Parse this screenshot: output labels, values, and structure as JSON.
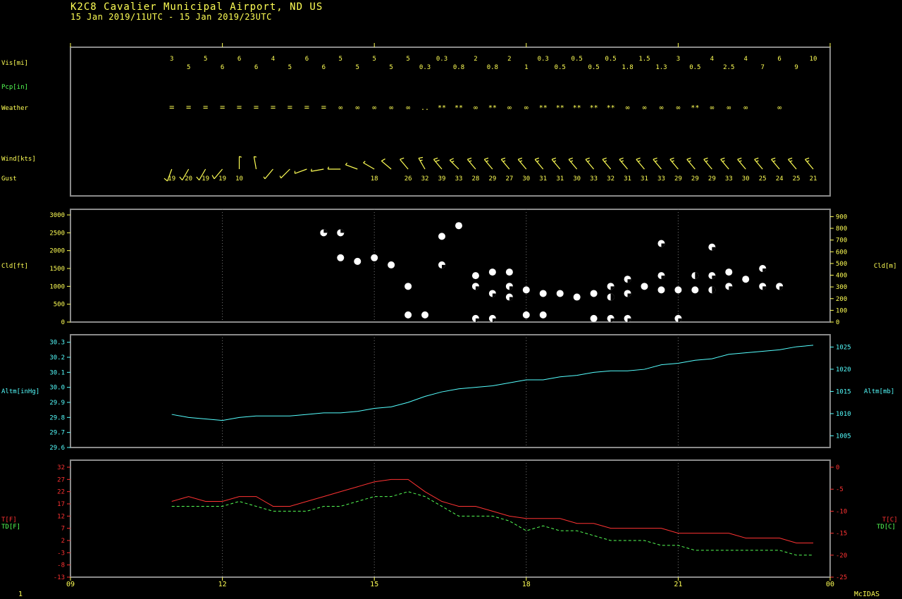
{
  "header": {
    "title": "K2C8  Cavalier Municipal Airport, ND US",
    "subtitle": "15 Jan 2019/11UTC - 15 Jan 2019/23UTC"
  },
  "footer": {
    "page": "1",
    "brand": "McIDAS"
  },
  "colors": {
    "yellow": "#ffff55",
    "green": "#55ff55",
    "cyan": "#55ffff",
    "red": "#ff3333",
    "panel": "#8a8a8a",
    "grid": "#777777"
  },
  "chart_data": [
    {
      "type": "table",
      "row_labels": {
        "vis": "Vis[mi]",
        "pcp": "Pcp[in]",
        "weather": "Weather",
        "wind": "Wind[kts]",
        "gust": "Gust"
      },
      "x_hours": [
        11,
        11.333,
        11.667,
        12,
        12.333,
        12.667,
        13,
        13.333,
        13.667,
        14,
        14.333,
        14.667,
        15,
        15.333,
        15.667,
        16,
        16.333,
        16.667,
        17,
        17.333,
        17.667,
        18,
        18.333,
        18.667,
        19,
        19.333,
        19.667,
        20,
        20.333,
        20.667,
        21,
        21.333,
        21.667,
        22,
        22.333,
        22.667,
        23,
        23.333,
        23.667
      ],
      "visibility": [
        "3",
        "5",
        "5",
        "6",
        "6",
        "6",
        "4",
        "5",
        "6",
        "6",
        "5",
        "5",
        "5",
        "5",
        "5",
        "0.3",
        "0.3",
        "0.8",
        "2",
        "0.8",
        "2",
        "1",
        "0.3",
        "0.5",
        "0.5",
        "0.5",
        "0.5",
        "1.8",
        "1.5",
        "1.3",
        "3",
        "0.5",
        "4",
        "2.5",
        "4",
        "7",
        "6",
        "9",
        "10"
      ],
      "weather": [
        "=",
        "=",
        "=",
        "=",
        "=",
        "=",
        "=",
        "=",
        "=",
        "=",
        "∞",
        "∞",
        "∞",
        "∞",
        "∞",
        "..",
        "**",
        "**",
        "∞",
        "**",
        "∞",
        "∞",
        "**",
        "**",
        "**",
        "**",
        "**",
        "∞",
        "∞",
        "∞",
        "∞",
        "**",
        "∞",
        "∞",
        "∞",
        "",
        "∞",
        "",
        ""
      ],
      "wind_dir_deg": [
        200,
        210,
        210,
        220,
        360,
        350,
        220,
        225,
        250,
        260,
        270,
        290,
        300,
        310,
        320,
        330,
        320,
        315,
        320,
        320,
        320,
        320,
        320,
        320,
        320,
        320,
        320,
        320,
        320,
        320,
        320,
        320,
        320,
        320,
        320,
        320,
        320,
        320,
        320
      ],
      "wind_speed_kts": [
        13,
        13,
        13,
        12,
        8,
        8,
        5,
        5,
        7,
        7,
        7,
        8,
        9,
        11,
        13,
        17,
        21,
        17,
        17,
        17,
        17,
        17,
        17,
        17,
        17,
        17,
        17,
        17,
        17,
        17,
        17,
        17,
        17,
        17,
        17,
        17,
        17,
        17,
        17
      ],
      "gusts": [
        {
          "x": 11,
          "v": "19"
        },
        {
          "x": 11.333,
          "v": "20"
        },
        {
          "x": 11.667,
          "v": "19"
        },
        {
          "x": 12,
          "v": "19"
        },
        {
          "x": 12.333,
          "v": "10"
        },
        {
          "x": 15,
          "v": "18"
        },
        {
          "x": 15.667,
          "v": "26"
        },
        {
          "x": 16,
          "v": "32"
        },
        {
          "x": 16.333,
          "v": "39"
        },
        {
          "x": 16.667,
          "v": "33"
        },
        {
          "x": 17,
          "v": "28"
        },
        {
          "x": 17.333,
          "v": "29"
        },
        {
          "x": 17.667,
          "v": "27"
        },
        {
          "x": 18,
          "v": "30"
        },
        {
          "x": 18.333,
          "v": "31"
        },
        {
          "x": 18.667,
          "v": "31"
        },
        {
          "x": 19,
          "v": "30"
        },
        {
          "x": 19.333,
          "v": "33"
        },
        {
          "x": 19.667,
          "v": "32"
        },
        {
          "x": 20,
          "v": "31"
        },
        {
          "x": 20.333,
          "v": "31"
        },
        {
          "x": 20.667,
          "v": "33"
        },
        {
          "x": 21,
          "v": "29"
        },
        {
          "x": 21.333,
          "v": "29"
        },
        {
          "x": 21.667,
          "v": "29"
        },
        {
          "x": 22,
          "v": "33"
        },
        {
          "x": 22.333,
          "v": "30"
        },
        {
          "x": 22.667,
          "v": "25"
        },
        {
          "x": 23,
          "v": "24"
        },
        {
          "x": 23.333,
          "v": "25"
        },
        {
          "x": 23.667,
          "v": "21"
        }
      ]
    },
    {
      "type": "scatter",
      "ylabel_left": "Cld[ft]",
      "ylabel_right": "Cld[m]",
      "ylim": [
        0,
        3000
      ],
      "yticks_left": [
        0,
        500,
        1000,
        1500,
        2000,
        2500,
        3000
      ],
      "yticks_right_m": [
        0,
        100,
        200,
        300,
        400,
        500,
        600,
        700,
        800,
        900
      ],
      "points": [
        {
          "x": 14,
          "y": 2500,
          "c": "few"
        },
        {
          "x": 14.333,
          "y": 2500,
          "c": "few"
        },
        {
          "x": 14.333,
          "y": 1800,
          "c": "ovc"
        },
        {
          "x": 14.667,
          "y": 1700,
          "c": "ovc"
        },
        {
          "x": 15,
          "y": 1800,
          "c": "ovc"
        },
        {
          "x": 15.333,
          "y": 1600,
          "c": "ovc"
        },
        {
          "x": 15.667,
          "y": 1000,
          "c": "ovc"
        },
        {
          "x": 15.667,
          "y": 200,
          "c": "ovc"
        },
        {
          "x": 16,
          "y": 200,
          "c": "ovc"
        },
        {
          "x": 16.333,
          "y": 2400,
          "c": "ovc"
        },
        {
          "x": 16.333,
          "y": 1600,
          "c": "bkn"
        },
        {
          "x": 16.667,
          "y": 2700,
          "c": "ovc"
        },
        {
          "x": 17,
          "y": 1300,
          "c": "ovc"
        },
        {
          "x": 17,
          "y": 1000,
          "c": "bkn"
        },
        {
          "x": 17,
          "y": 100,
          "c": "bkn"
        },
        {
          "x": 17.333,
          "y": 1400,
          "c": "ovc"
        },
        {
          "x": 17.333,
          "y": 800,
          "c": "bkn"
        },
        {
          "x": 17.333,
          "y": 100,
          "c": "bkn"
        },
        {
          "x": 17.667,
          "y": 1400,
          "c": "ovc"
        },
        {
          "x": 17.667,
          "y": 1000,
          "c": "bkn"
        },
        {
          "x": 17.667,
          "y": 700,
          "c": "bkn"
        },
        {
          "x": 18,
          "y": 900,
          "c": "ovc"
        },
        {
          "x": 18,
          "y": 200,
          "c": "ovc"
        },
        {
          "x": 18.333,
          "y": 800,
          "c": "ovc"
        },
        {
          "x": 18.333,
          "y": 200,
          "c": "ovc"
        },
        {
          "x": 18.667,
          "y": 800,
          "c": "ovc"
        },
        {
          "x": 19,
          "y": 700,
          "c": "ovc"
        },
        {
          "x": 19.333,
          "y": 800,
          "c": "ovc"
        },
        {
          "x": 19.333,
          "y": 100,
          "c": "ovc"
        },
        {
          "x": 19.667,
          "y": 1000,
          "c": "bkn"
        },
        {
          "x": 19.667,
          "y": 700,
          "c": "sct"
        },
        {
          "x": 19.667,
          "y": 100,
          "c": "bkn"
        },
        {
          "x": 20,
          "y": 1200,
          "c": "bkn"
        },
        {
          "x": 20,
          "y": 800,
          "c": "bkn"
        },
        {
          "x": 20,
          "y": 100,
          "c": "bkn"
        },
        {
          "x": 20.333,
          "y": 1000,
          "c": "ovc"
        },
        {
          "x": 20.667,
          "y": 2200,
          "c": "bkn"
        },
        {
          "x": 20.667,
          "y": 1300,
          "c": "bkn"
        },
        {
          "x": 20.667,
          "y": 900,
          "c": "ovc"
        },
        {
          "x": 21,
          "y": 900,
          "c": "ovc"
        },
        {
          "x": 21,
          "y": 100,
          "c": "bkn"
        },
        {
          "x": 21.333,
          "y": 1300,
          "c": "sct"
        },
        {
          "x": 21.333,
          "y": 900,
          "c": "ovc"
        },
        {
          "x": 21.667,
          "y": 2100,
          "c": "bkn"
        },
        {
          "x": 21.667,
          "y": 1300,
          "c": "bkn"
        },
        {
          "x": 21.667,
          "y": 900,
          "c": "sct"
        },
        {
          "x": 22,
          "y": 1400,
          "c": "ovc"
        },
        {
          "x": 22,
          "y": 1000,
          "c": "bkn"
        },
        {
          "x": 22.333,
          "y": 1200,
          "c": "ovc"
        },
        {
          "x": 22.667,
          "y": 1500,
          "c": "bkn"
        },
        {
          "x": 22.667,
          "y": 1000,
          "c": "bkn"
        },
        {
          "x": 23,
          "y": 1000,
          "c": "bkn"
        }
      ]
    },
    {
      "type": "line",
      "ylabel_left": "Altm[inHg]",
      "ylabel_right": "Altm[mb]",
      "ylim": [
        29.6,
        30.35
      ],
      "yticks_left": [
        29.6,
        29.7,
        29.8,
        29.9,
        30.0,
        30.1,
        30.2,
        30.3
      ],
      "yticks_right_mb": [
        1005,
        1010,
        1015,
        1020,
        1025
      ],
      "series": [
        {
          "color": "#55ffff",
          "x": [
            11,
            11.333,
            11.667,
            12,
            12.333,
            12.667,
            13,
            13.333,
            13.667,
            14,
            14.333,
            14.667,
            15,
            15.333,
            15.667,
            16,
            16.333,
            16.667,
            17,
            17.333,
            17.667,
            18,
            18.333,
            18.667,
            19,
            19.333,
            19.667,
            20,
            20.333,
            20.667,
            21,
            21.333,
            21.667,
            22,
            22.333,
            22.667,
            23,
            23.333,
            23.667
          ],
          "y": [
            29.82,
            29.8,
            29.79,
            29.78,
            29.8,
            29.81,
            29.81,
            29.81,
            29.82,
            29.83,
            29.83,
            29.84,
            29.86,
            29.87,
            29.9,
            29.94,
            29.97,
            29.99,
            30.0,
            30.01,
            30.03,
            30.05,
            30.05,
            30.07,
            30.08,
            30.1,
            30.11,
            30.11,
            30.12,
            30.15,
            30.16,
            30.18,
            30.19,
            30.22,
            30.23,
            30.24,
            30.25,
            30.27,
            30.28
          ]
        }
      ]
    },
    {
      "type": "line",
      "ylabel_left": [
        "T[F]",
        "TD[F]"
      ],
      "ylabel_right": [
        "T[C]",
        "TD[C]"
      ],
      "ylim": [
        -13,
        32
      ],
      "yticks_left": [
        -13,
        -8,
        -3,
        2,
        7,
        12,
        17,
        22,
        27,
        32
      ],
      "yticks_right_c": [
        -25,
        -20,
        -15,
        -10,
        -5,
        0
      ],
      "xlim": [
        9,
        24
      ],
      "xticks": [
        9,
        12,
        15,
        18,
        21,
        24
      ],
      "xtick_labels": [
        "09",
        "12",
        "15",
        "18",
        "21",
        "00"
      ],
      "series": [
        {
          "name": "T",
          "color": "#ff3333",
          "dash": false,
          "x": [
            11,
            11.333,
            11.667,
            12,
            12.333,
            12.667,
            13,
            13.333,
            13.667,
            14,
            14.333,
            14.667,
            15,
            15.333,
            15.667,
            16,
            16.333,
            16.667,
            17,
            17.333,
            17.667,
            18,
            18.333,
            18.667,
            19,
            19.333,
            19.667,
            20,
            20.333,
            20.667,
            21,
            21.333,
            21.667,
            22,
            22.333,
            22.667,
            23,
            23.333,
            23.667
          ],
          "y": [
            18,
            20,
            18,
            18,
            20,
            20,
            16,
            16,
            18,
            20,
            22,
            24,
            26,
            27,
            27,
            22,
            18,
            16,
            16,
            14,
            12,
            11,
            11,
            11,
            9,
            9,
            7,
            7,
            7,
            7,
            5,
            5,
            5,
            5,
            3,
            3,
            3,
            1,
            1
          ]
        },
        {
          "name": "TD",
          "color": "#55ff55",
          "dash": true,
          "x": [
            11,
            11.333,
            11.667,
            12,
            12.333,
            12.667,
            13,
            13.333,
            13.667,
            14,
            14.333,
            14.667,
            15,
            15.333,
            15.667,
            16,
            16.333,
            16.667,
            17,
            17.333,
            17.667,
            18,
            18.333,
            18.667,
            19,
            19.333,
            19.667,
            20,
            20.333,
            20.667,
            21,
            21.333,
            21.667,
            22,
            22.333,
            22.667,
            23,
            23.333,
            23.667
          ],
          "y": [
            16,
            16,
            16,
            16,
            18,
            16,
            14,
            14,
            14,
            16,
            16,
            18,
            20,
            20,
            22,
            20,
            16,
            12,
            12,
            12,
            10,
            6,
            8,
            6,
            6,
            4,
            2,
            2,
            2,
            0,
            0,
            -2,
            -2,
            -2,
            -2,
            -2,
            -2,
            -4,
            -4
          ]
        }
      ]
    }
  ]
}
